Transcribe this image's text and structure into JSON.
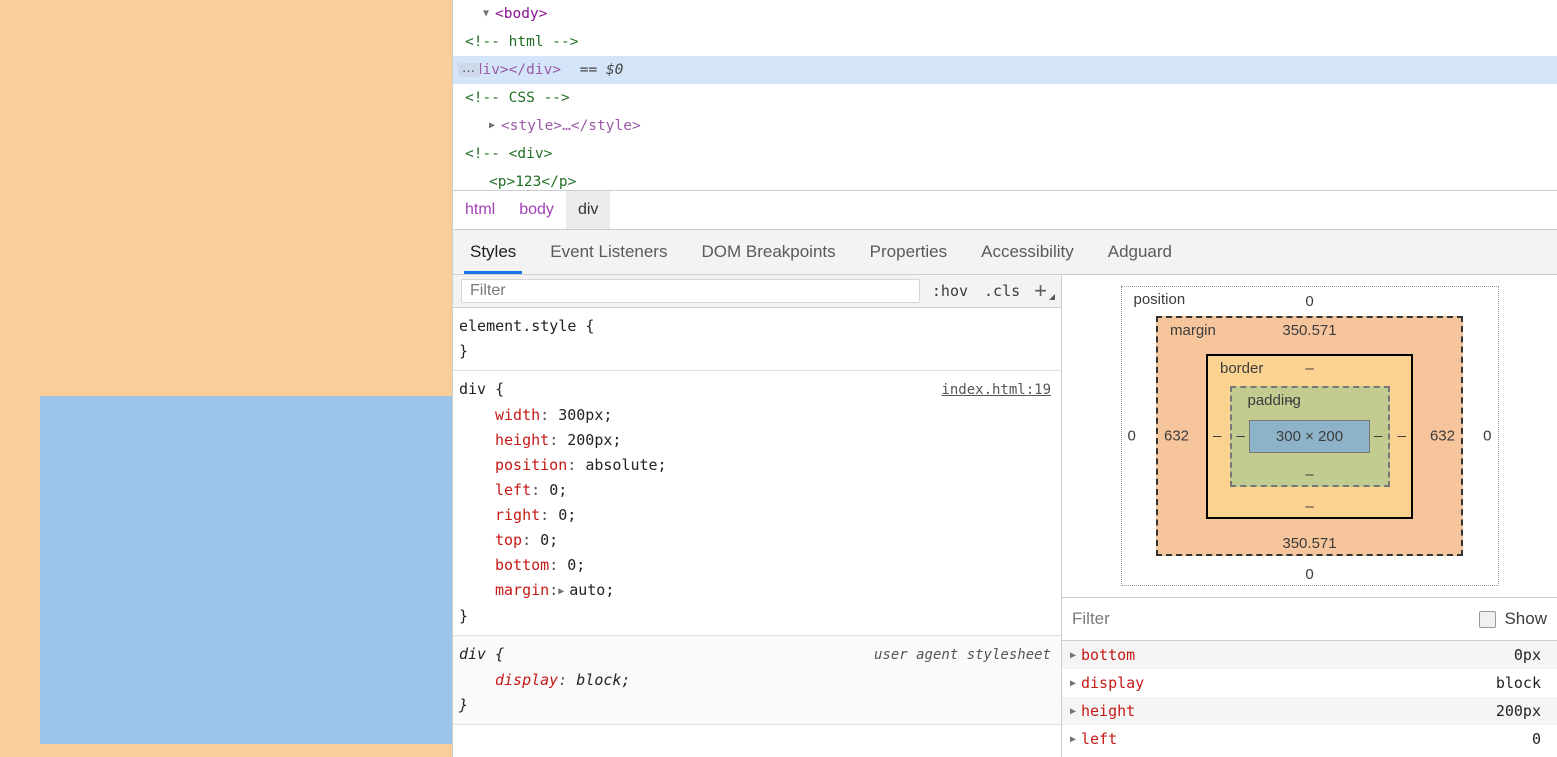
{
  "page_render": {
    "background_color": "#f9ce9b",
    "highlight_color": "#9cc3e8"
  },
  "dom_tree": {
    "rows": [
      {
        "id": "body-open",
        "indent": 0,
        "triangle": "▼",
        "text": "<body>",
        "kind": "tag",
        "selected": false,
        "badge": ""
      },
      {
        "id": "comment-html",
        "indent": 1,
        "triangle": "",
        "text": "<!-- html -->",
        "kind": "comment",
        "selected": false,
        "badge": ""
      },
      {
        "id": "div-node",
        "indent": 1,
        "triangle": "",
        "text": "<div></div>",
        "kind": "tag",
        "selected": true,
        "badge": "…",
        "suffix": "== $0"
      },
      {
        "id": "comment-css",
        "indent": 1,
        "triangle": "",
        "text": "<!-- CSS -->",
        "kind": "comment",
        "selected": false,
        "badge": ""
      },
      {
        "id": "style-node",
        "indent": 0,
        "triangle": "▶",
        "text": "<style>…</style>",
        "kind": "tag",
        "selected": false,
        "badge": ""
      },
      {
        "id": "comment-div",
        "indent": 1,
        "triangle": "",
        "text": "<!-- <div>",
        "kind": "comment",
        "selected": false,
        "badge": ""
      },
      {
        "id": "comment-p",
        "indent": 2,
        "triangle": "",
        "text": "<p>123</p>",
        "kind": "comment",
        "selected": false,
        "badge": ""
      }
    ]
  },
  "breadcrumb": {
    "items": [
      {
        "label": "html",
        "selected": false
      },
      {
        "label": "body",
        "selected": false
      },
      {
        "label": "div",
        "selected": true
      }
    ]
  },
  "tabs": {
    "items": [
      {
        "label": "Styles",
        "active": true
      },
      {
        "label": "Event Listeners",
        "active": false
      },
      {
        "label": "DOM Breakpoints",
        "active": false
      },
      {
        "label": "Properties",
        "active": false
      },
      {
        "label": "Accessibility",
        "active": false
      },
      {
        "label": "Adguard",
        "active": false
      }
    ]
  },
  "styles_toolbar": {
    "filter_placeholder": "Filter",
    "hov_label": ":hov",
    "cls_label": ".cls",
    "plus_label": "+"
  },
  "style_rules": [
    {
      "id": "element-style",
      "selector": "element.style {",
      "origin": "",
      "origin_link": false,
      "declarations": [],
      "user_agent": false
    },
    {
      "id": "div-author",
      "selector": "div {",
      "origin": "index.html:19",
      "origin_link": true,
      "user_agent": false,
      "declarations": [
        {
          "prop": "width",
          "value": "300px;",
          "expandable": false
        },
        {
          "prop": "height",
          "value": "200px;",
          "expandable": false
        },
        {
          "prop": "position",
          "value": "absolute;",
          "expandable": false
        },
        {
          "prop": "left",
          "value": "0;",
          "expandable": false
        },
        {
          "prop": "right",
          "value": "0;",
          "expandable": false
        },
        {
          "prop": "top",
          "value": "0;",
          "expandable": false
        },
        {
          "prop": "bottom",
          "value": "0;",
          "expandable": false
        },
        {
          "prop": "margin",
          "value": "auto;",
          "expandable": true
        }
      ]
    },
    {
      "id": "div-ua",
      "selector": "div {",
      "origin": "user agent stylesheet",
      "origin_link": false,
      "user_agent": true,
      "declarations": [
        {
          "prop": "display",
          "value": "block;",
          "expandable": false
        }
      ]
    }
  ],
  "box_model": {
    "position": {
      "label": "position",
      "top": "0",
      "right": "0",
      "bottom": "0",
      "left": "0"
    },
    "margin": {
      "label": "margin",
      "top": "350.571",
      "right": "632",
      "bottom": "350.571",
      "left": "632"
    },
    "border": {
      "label": "border",
      "top": "–",
      "right": "–",
      "bottom": "–",
      "left": "–"
    },
    "padding": {
      "label": "padding",
      "top": "–",
      "right": "–",
      "bottom": "–",
      "left": "–"
    },
    "content": {
      "label": "300 × 200"
    },
    "colors": {
      "margin": "#f7c59c",
      "border": "#fbd28f",
      "padding": "#c2cc90",
      "content": "#8cb3c7"
    }
  },
  "computed": {
    "filter_placeholder": "Filter",
    "show_all_label": "Show",
    "rows": [
      {
        "name": "bottom",
        "value": "0px"
      },
      {
        "name": "display",
        "value": "block"
      },
      {
        "name": "height",
        "value": "200px"
      },
      {
        "name": "left",
        "value": "0"
      }
    ]
  }
}
